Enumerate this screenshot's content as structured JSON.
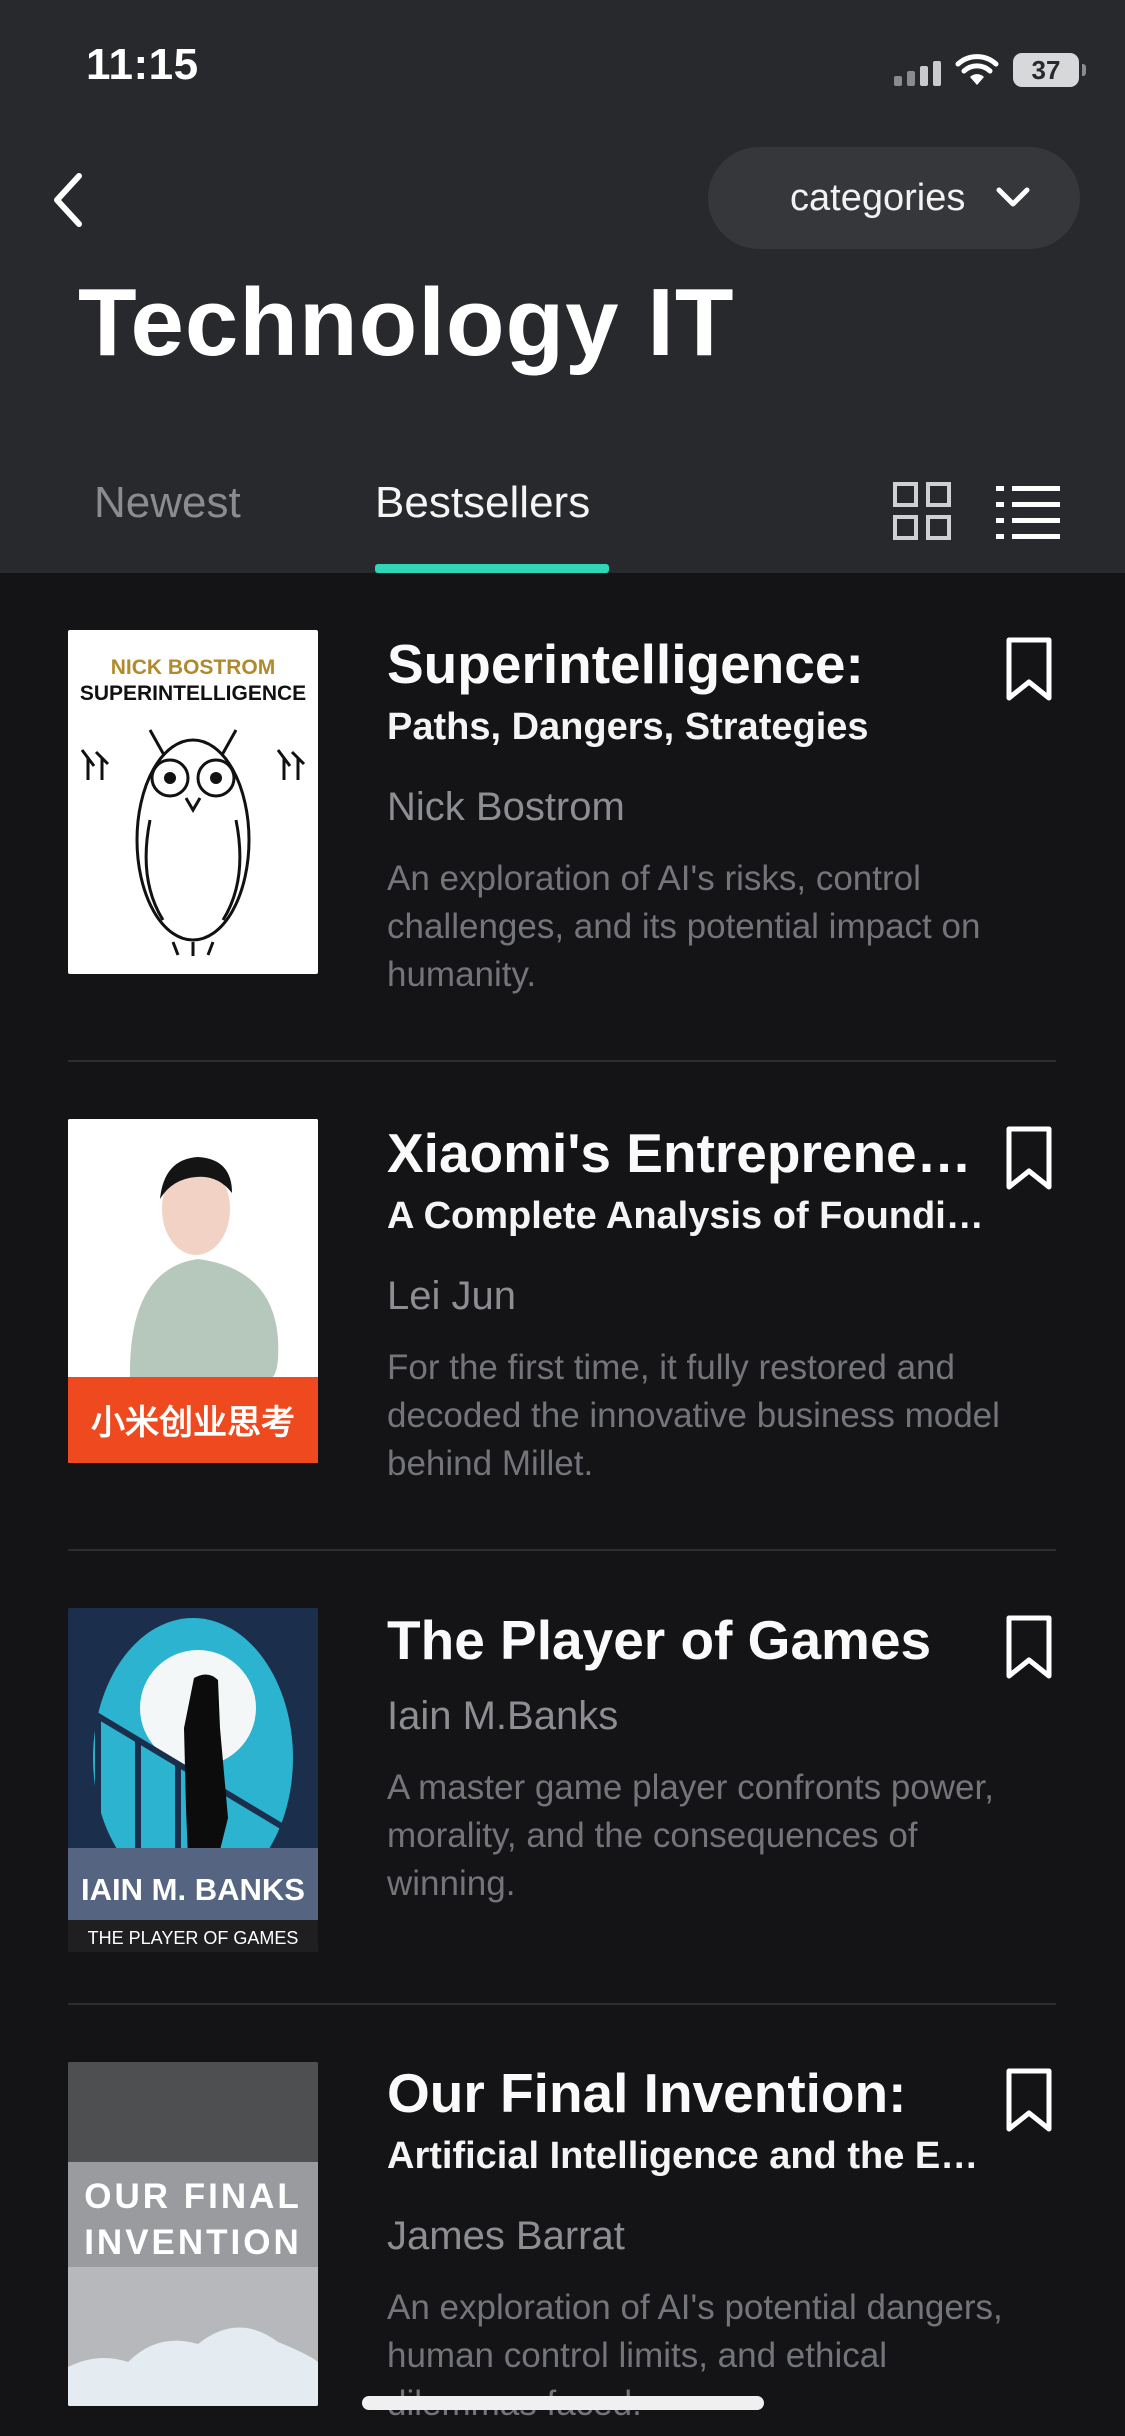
{
  "status": {
    "time": "11:15",
    "battery": "37"
  },
  "nav": {
    "categories_label": "categories"
  },
  "page": {
    "title": "Technology IT"
  },
  "tabs": [
    {
      "label": "Newest",
      "active": false
    },
    {
      "label": "Bestsellers",
      "active": true
    }
  ],
  "colors": {
    "accent": "#2fd6b7",
    "header_bg": "#28292c",
    "list_bg": "#141416"
  },
  "books": [
    {
      "title": "Superintelligence:",
      "subtitle": "Paths, Dangers, Strategies",
      "author": "Nick Bostrom",
      "description": "An exploration of AI's risks, control challenges, and its potential impact on humanity.",
      "cover": {
        "top_text": "NICK BOSTROM",
        "main_text": "SUPERINTELLIGENCE"
      }
    },
    {
      "title": "Xiaomi's Entrepreneurship",
      "subtitle": "A Complete Analysis of Founding",
      "author": "Lei Jun",
      "description": "For the first time, it fully restored and decoded the innovative business model behind Millet.",
      "cover": {
        "banner_text": "小米创业思考"
      }
    },
    {
      "title": "The Player of Games",
      "subtitle": "",
      "author": "Iain M.Banks",
      "description": "A master game player confronts power, morality, and the consequences of winning.",
      "cover": {
        "author_text": "IAIN  M. BANKS",
        "title_text": "THE PLAYER OF GAMES"
      }
    },
    {
      "title": "Our Final Invention:",
      "subtitle": "Artificial Intelligence and the End of the Human Era",
      "author": "James Barrat",
      "description": "An exploration of AI's potential dangers, human control limits, and ethical dilemmas faced.",
      "cover": {
        "line1": "OUR FINAL",
        "line2": "INVENTION"
      }
    }
  ]
}
